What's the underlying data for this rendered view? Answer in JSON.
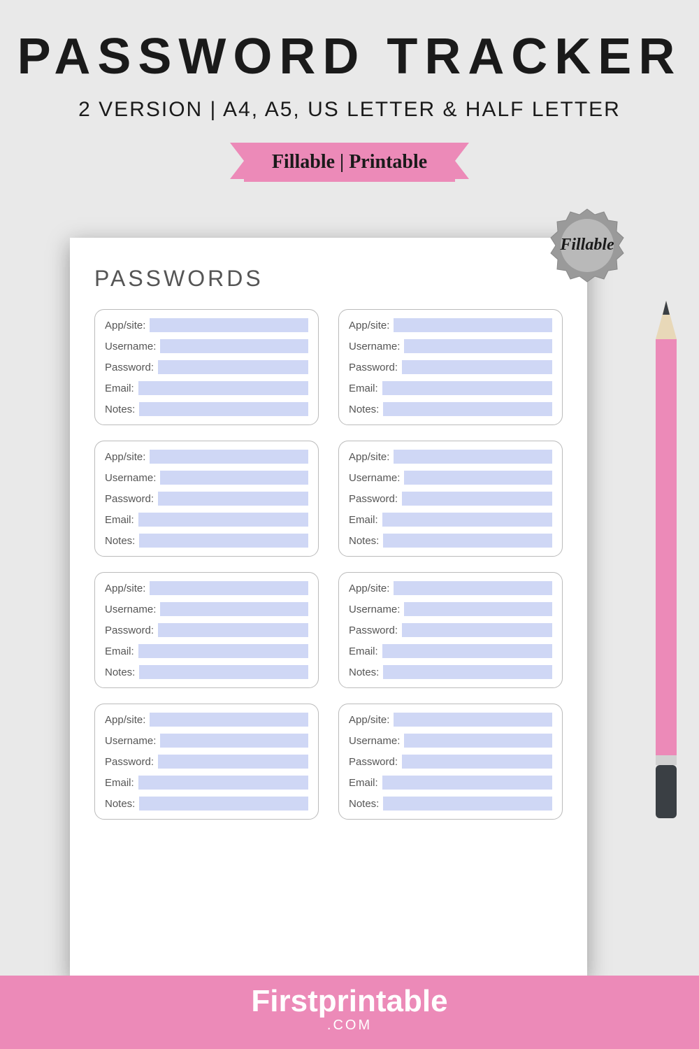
{
  "header": {
    "title": "PASSWORD TRACKER",
    "subtitle": "2 VERSION | A4, A5, US LETTER & HALF LETTER",
    "ribbon": "Fillable | Printable"
  },
  "badge": {
    "text": "Fillable"
  },
  "page": {
    "heading": "PASSWORDS",
    "fields": {
      "appsite": "App/site:",
      "username": "Username:",
      "password": "Password:",
      "email": "Email:",
      "notes": "Notes:"
    },
    "card_count": 8
  },
  "footer": {
    "name": "Firstprintable",
    "ext": ".COM"
  },
  "colors": {
    "pink": "#ec8ab8",
    "field": "#cfd7f5",
    "badge": "#9a9a9a"
  }
}
